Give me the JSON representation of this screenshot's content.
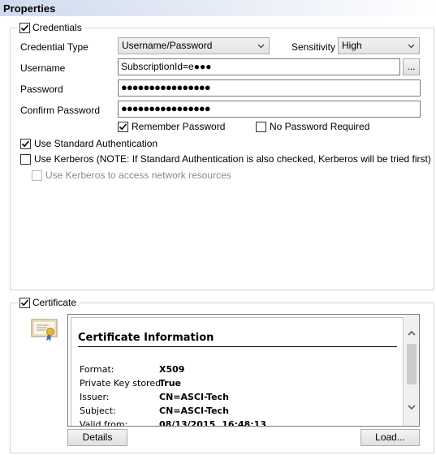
{
  "header": {
    "title": "Properties"
  },
  "credentials": {
    "legend": "Credentials",
    "credential_type_label": "Credential Type",
    "credential_type_value": "Username/Password",
    "sensitivity_label": "Sensitivity",
    "sensitivity_value": "High",
    "username_label": "Username",
    "username_value": "SubscriptionId=e●●●",
    "browse_label": "...",
    "password_label": "Password",
    "password_value": "●●●●●●●●●●●●●●●●",
    "confirm_password_label": "Confirm Password",
    "confirm_password_value": "●●●●●●●●●●●●●●●●",
    "remember_password_label": "Remember Password",
    "no_password_label": "No Password Required",
    "use_standard_auth_label": "Use Standard Authentication",
    "use_kerberos_label": "Use Kerberos (NOTE: If Standard Authentication is also checked, Kerberos will be tried first)",
    "kerberos_network_label": "Use Kerberos to access network resources"
  },
  "certificate": {
    "legend": "Certificate",
    "info_title": "Certificate Information",
    "fields": [
      {
        "key": "Format:",
        "value": "X509"
      },
      {
        "key": "Private Key stored:",
        "value": "True"
      },
      {
        "key": "Issuer:",
        "value": "CN=ASCI-Tech"
      },
      {
        "key": "Subject:",
        "value": "CN=ASCI-Tech"
      },
      {
        "key": "Valid from:",
        "value": "08/13/2015, 16:48:13"
      }
    ],
    "details_label": "Details",
    "load_label": "Load..."
  },
  "colors": {
    "header_gradient_start": "#cfdbee",
    "group_border": "#d5d5d5"
  }
}
